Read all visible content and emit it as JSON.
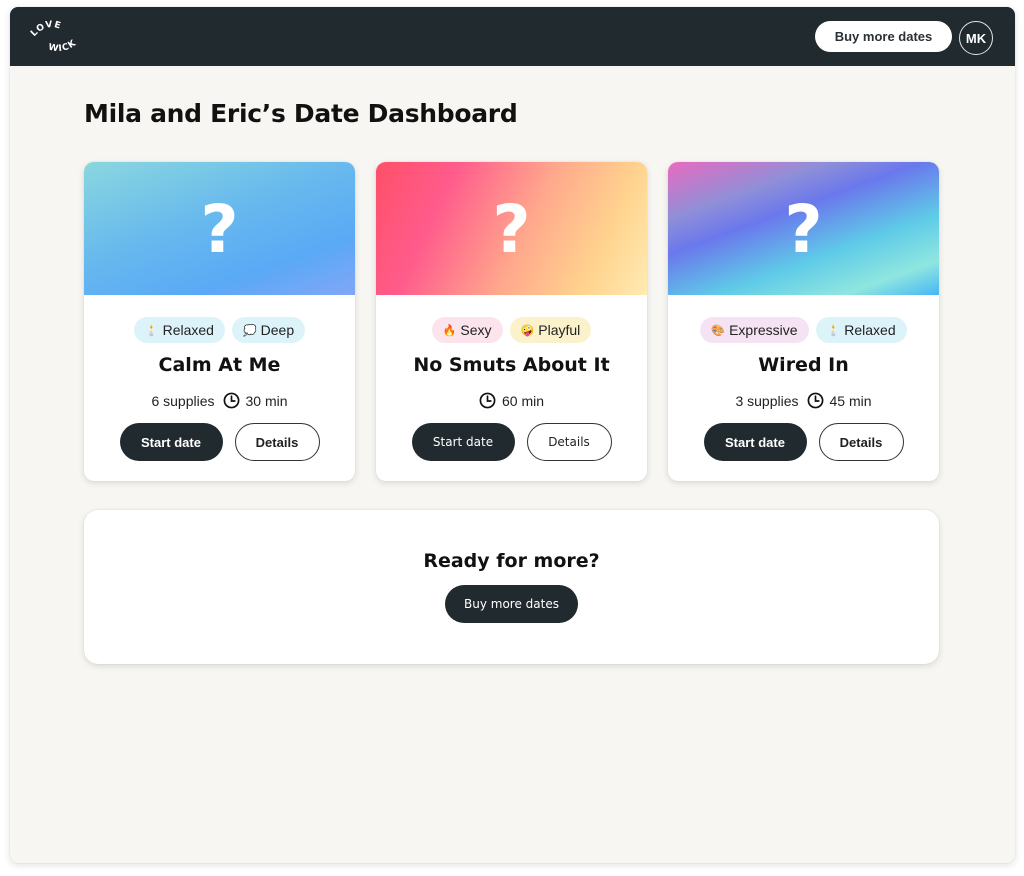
{
  "header": {
    "logo_line1": "LOVE",
    "logo_line2": "WICK",
    "buy_button": "Buy more dates",
    "avatar_initials": "MK"
  },
  "page": {
    "title": "Mila and Eric’s Date Dashboard"
  },
  "cards": [
    {
      "hero_icon": "question-mark",
      "hero_text": "?",
      "tags": [
        {
          "emoji": "🕯️",
          "icon": "candle-icon",
          "label": "Relaxed"
        },
        {
          "emoji": "💭",
          "icon": "thought-bubble-icon",
          "label": "Deep"
        }
      ],
      "title": "Calm At Me",
      "supplies": "6 supplies",
      "duration": "30 min",
      "start_label": "Start date",
      "details_label": "Details"
    },
    {
      "hero_icon": "question-mark",
      "hero_text": "?",
      "tags": [
        {
          "emoji": "🔥",
          "icon": "fire-icon",
          "label": "Sexy"
        },
        {
          "emoji": "🤪",
          "icon": "zany-face-icon",
          "label": "Playful"
        }
      ],
      "title": "No Smuts About It",
      "supplies": "",
      "duration": "60 min",
      "start_label": "Start date",
      "details_label": "Details"
    },
    {
      "hero_icon": "question-mark",
      "hero_text": "?",
      "tags": [
        {
          "emoji": "🎨",
          "icon": "palette-icon",
          "label": "Expressive"
        },
        {
          "emoji": "🕯️",
          "icon": "candle-icon",
          "label": "Relaxed"
        }
      ],
      "title": "Wired In",
      "supplies": "3 supplies",
      "duration": "45 min",
      "start_label": "Start date",
      "details_label": "Details"
    }
  ],
  "more": {
    "title": "Ready for more?",
    "button": "Buy more dates"
  },
  "colors": {
    "topbar": "#212a2f",
    "page_bg": "#f7f6f2",
    "primary_button": "#212a2f",
    "tag_blue": "#ddf3fa",
    "tag_pink": "#fbe4ec",
    "tag_yellow": "#fbf2cc",
    "tag_lilac": "#f5e3f3"
  }
}
